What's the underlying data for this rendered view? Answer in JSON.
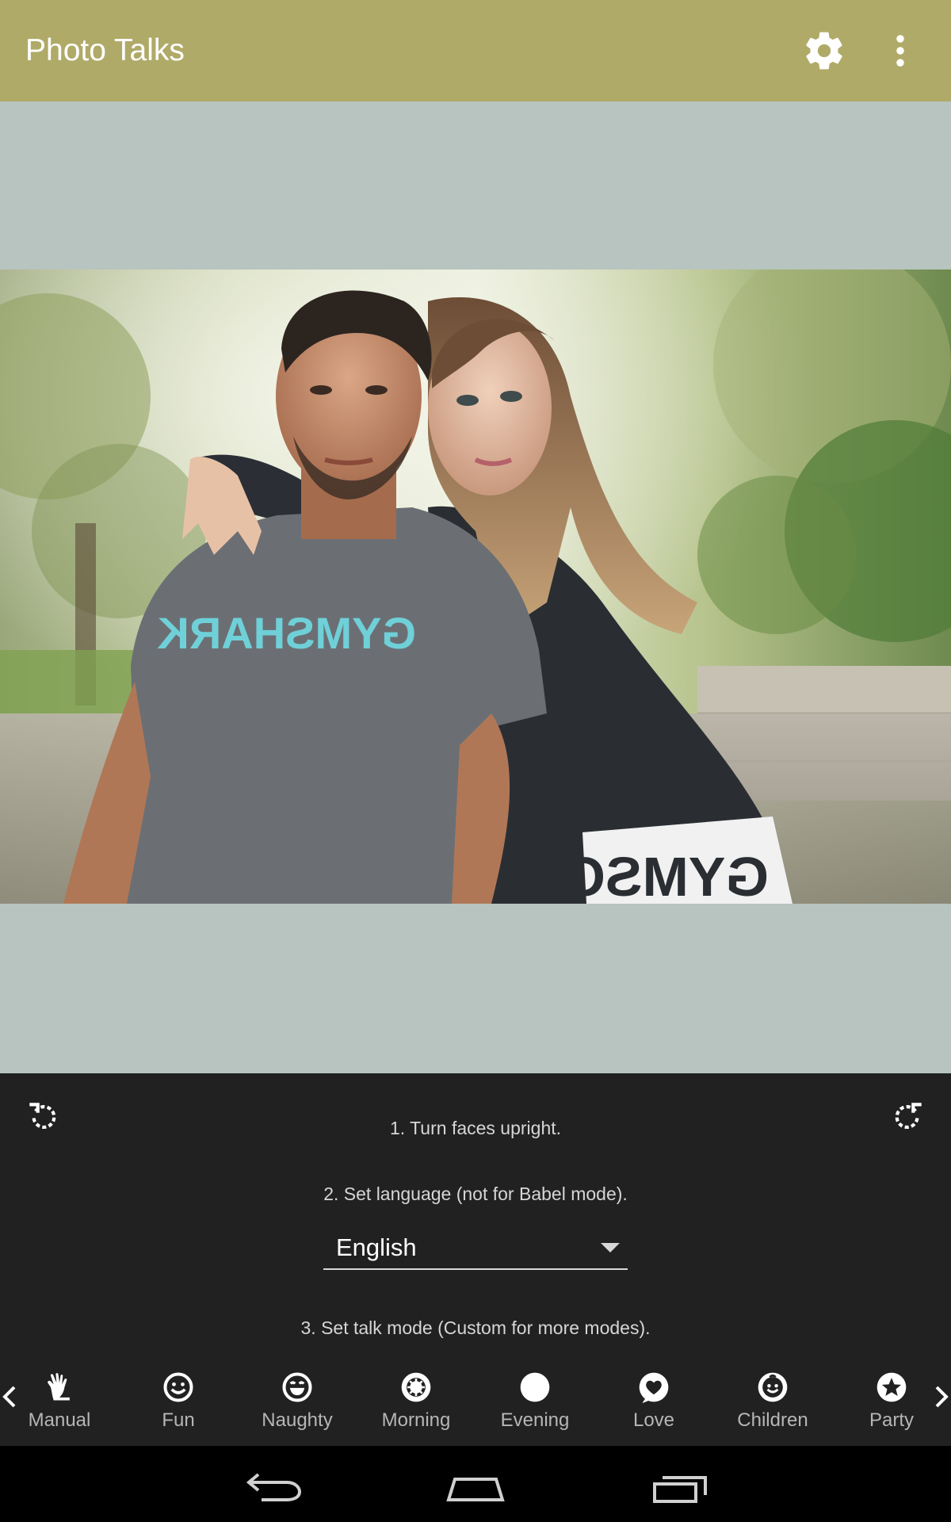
{
  "appbar": {
    "title": "Photo Talks",
    "settings_icon": "gear-icon",
    "overflow_icon": "more-vertical-icon"
  },
  "photo": {
    "shirt_text": "GYMSHARK",
    "hem_text": "GYMSO"
  },
  "panel": {
    "step1": "1. Turn faces upright.",
    "step2": "2. Set language (not for Babel mode).",
    "language_value": "English",
    "step3": "3. Set talk mode (Custom for more modes)."
  },
  "modes": [
    {
      "label": "Manual",
      "icon": "hand-icon"
    },
    {
      "label": "Fun",
      "icon": "smiley-icon"
    },
    {
      "label": "Naughty",
      "icon": "grin-icon"
    },
    {
      "label": "Morning",
      "icon": "sun-icon"
    },
    {
      "label": "Evening",
      "icon": "moon-icon"
    },
    {
      "label": "Love",
      "icon": "heart-icon"
    },
    {
      "label": "Children",
      "icon": "child-icon"
    },
    {
      "label": "Party",
      "icon": "star-icon"
    }
  ],
  "colors": {
    "appbar": "#b0aa68",
    "canvas": "#b7c4bf",
    "panel": "#212121",
    "navbar": "#000000"
  }
}
